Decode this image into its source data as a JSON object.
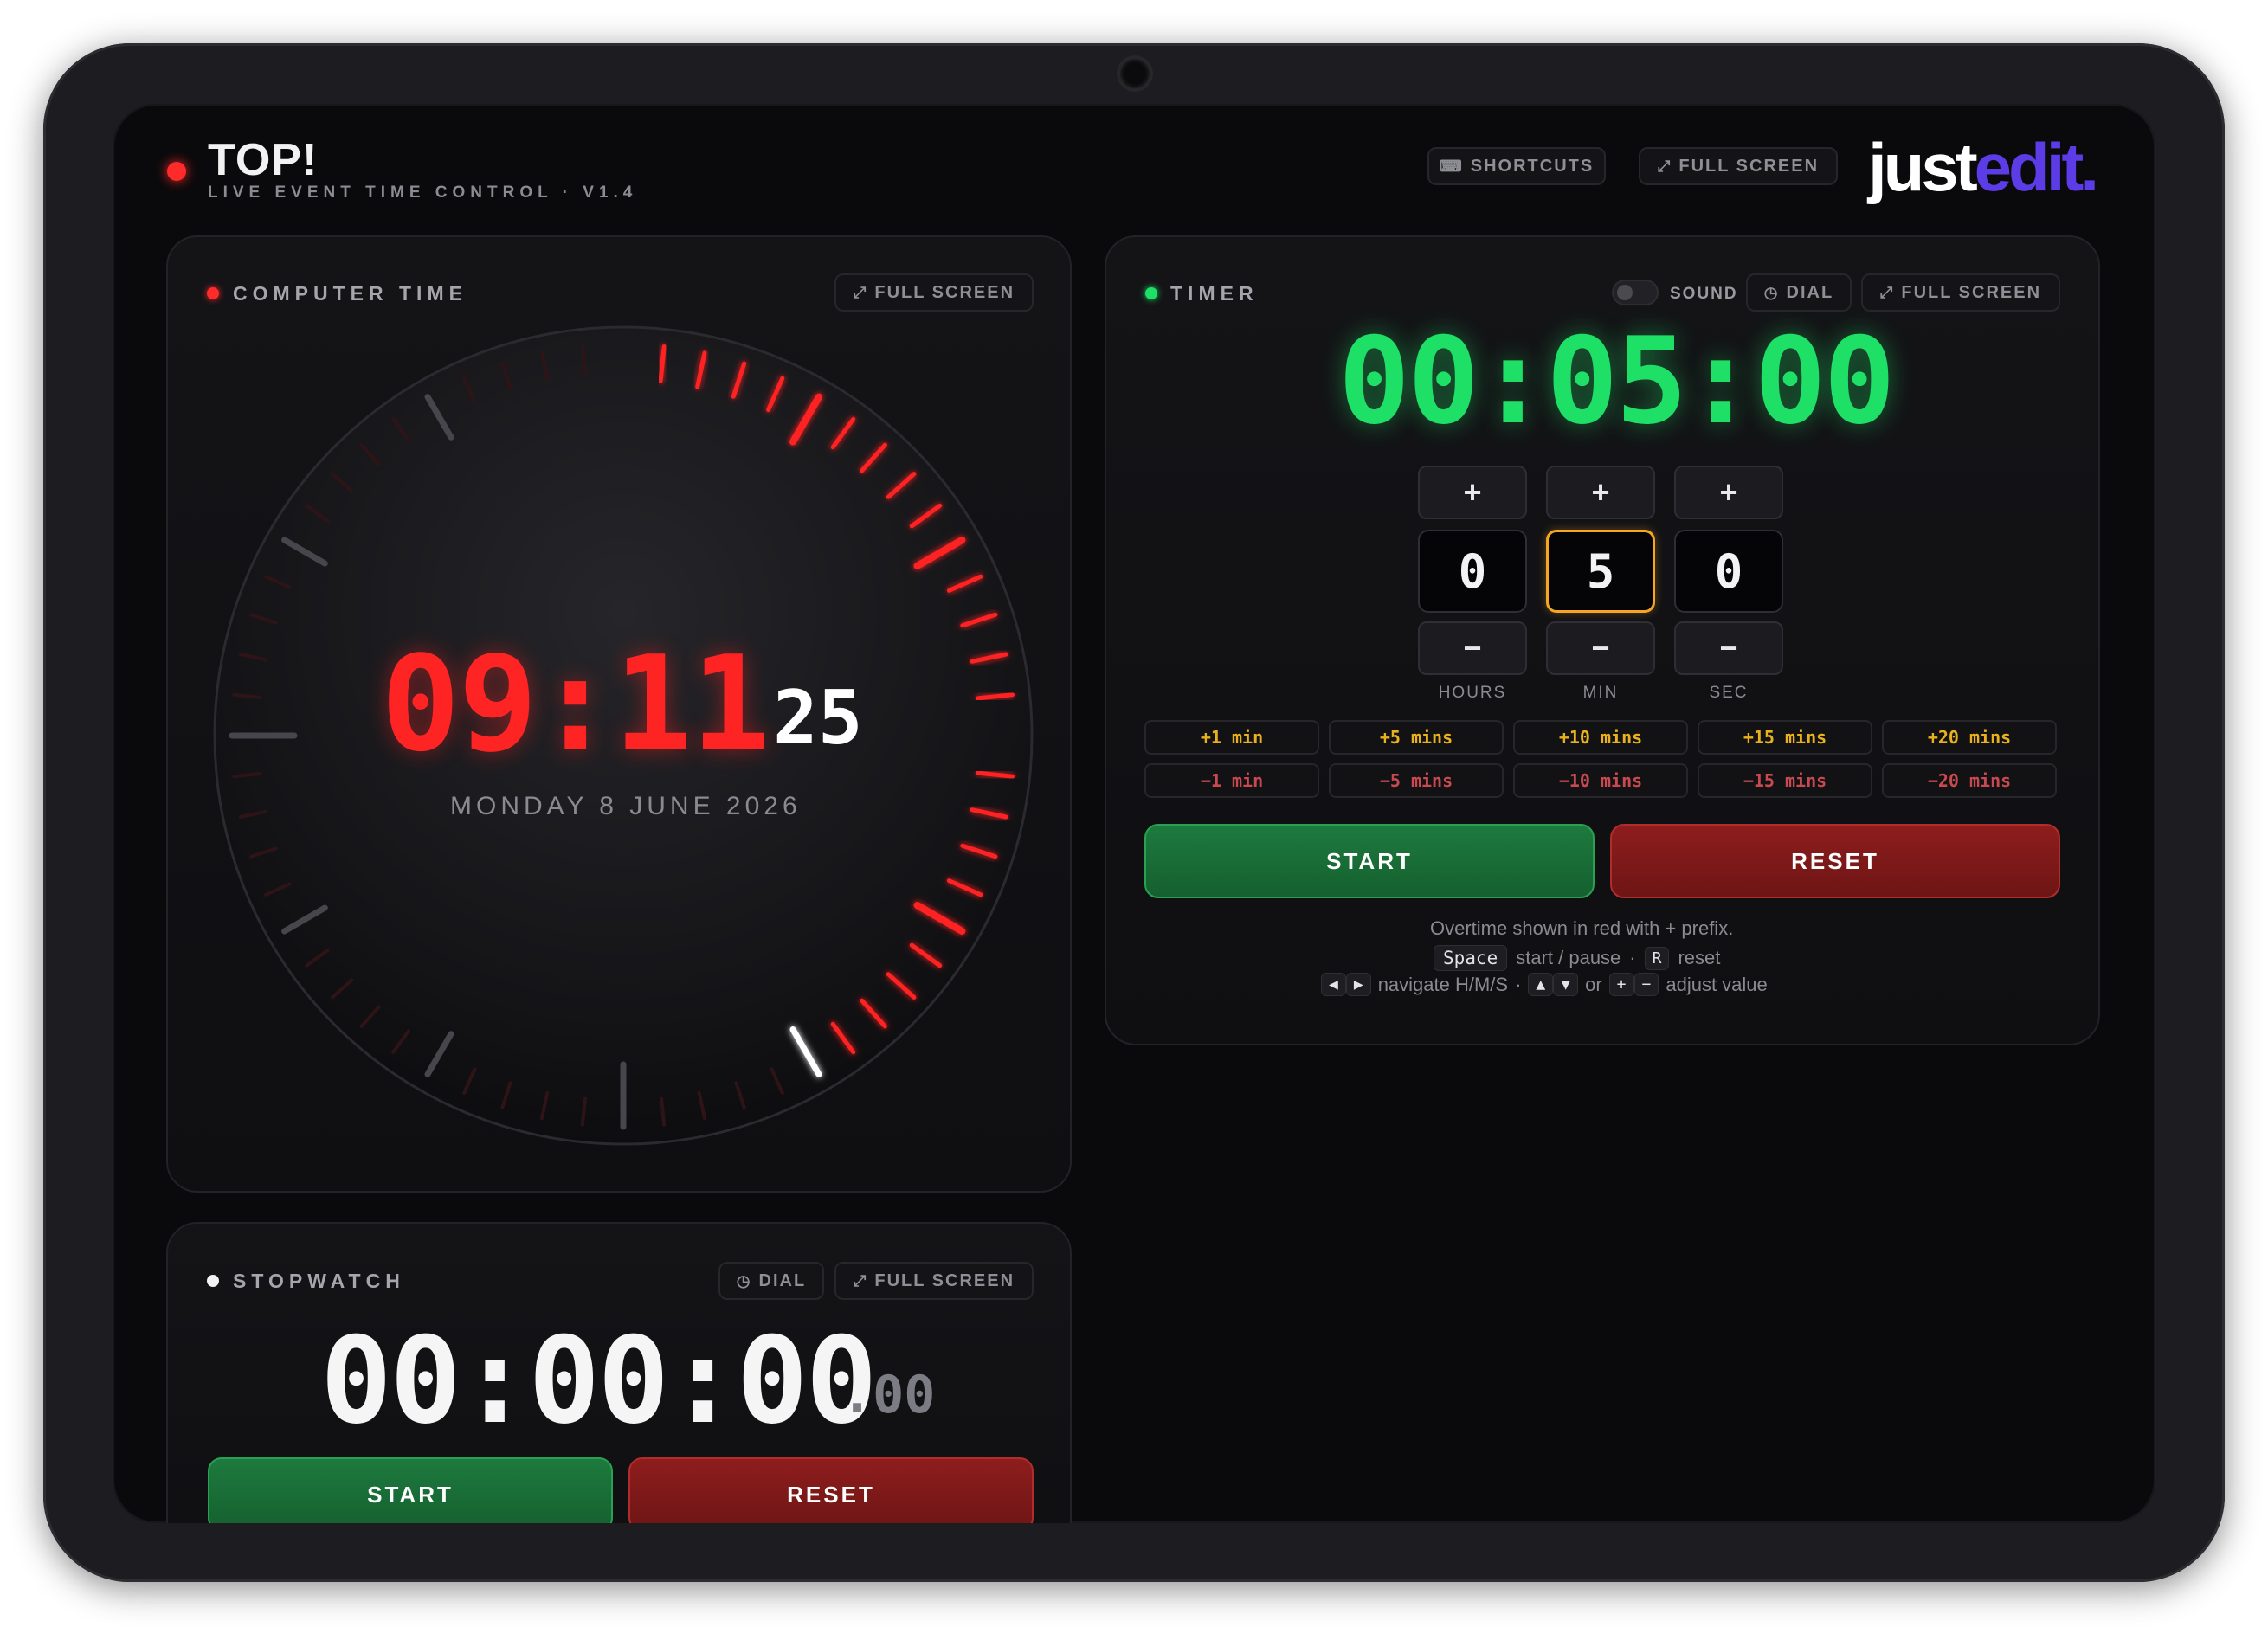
{
  "app": {
    "title": "TOP!",
    "subtitle": "LIVE EVENT TIME CONTROL · V1.4",
    "shortcuts_label": "SHORTCUTS",
    "fullscreen_label": "FULL SCREEN",
    "logo_word1": "just",
    "logo_word2": "edit."
  },
  "clock": {
    "label": "COMPUTER TIME",
    "fullscreen_label": "FULL SCREEN",
    "hours_minutes": "09:11",
    "seconds": "25",
    "date": "MONDAY 8 JUNE 2026",
    "seconds_value": 25
  },
  "timer": {
    "label": "TIMER",
    "sound_label": "SOUND",
    "sound_enabled": false,
    "dial_label": "DIAL",
    "fullscreen_label": "FULL SCREEN",
    "display": "00:05:00",
    "plus": "+",
    "minus": "−",
    "hours_value": "0",
    "min_value": "5",
    "sec_value": "0",
    "hours_label": "HOURS",
    "min_label": "MIN",
    "sec_label": "SEC",
    "presets_plus": [
      "+1 min",
      "+5 mins",
      "+10 mins",
      "+15 mins",
      "+20 mins"
    ],
    "presets_minus": [
      "−1 min",
      "−5 mins",
      "−10 mins",
      "−15 mins",
      "−20 mins"
    ],
    "start_label": "START",
    "reset_label": "RESET",
    "help_line1": "Overtime shown in red with + prefix.",
    "key_space": "Space",
    "help_start_pause": "start / pause",
    "sep": "·",
    "key_r": "R",
    "help_reset": "reset",
    "key_left": "◀",
    "key_right": "▶",
    "help_navigate": "navigate H/M/S",
    "key_up": "▲",
    "key_down": "▼",
    "help_or": "or",
    "key_plus": "+",
    "key_minus": "−",
    "help_adjust": "adjust value"
  },
  "stopwatch": {
    "label": "STOPWATCH",
    "dial_label": "DIAL",
    "fullscreen_label": "FULL SCREEN",
    "display": "00:00:00",
    "centiseconds": ".00",
    "start_label": "START",
    "reset_label": "RESET"
  },
  "colors": {
    "clock_red": "#ff2424",
    "timer_green": "#1fe066",
    "accent_purple": "#5b3ce6",
    "active_field": "#f5a623"
  }
}
